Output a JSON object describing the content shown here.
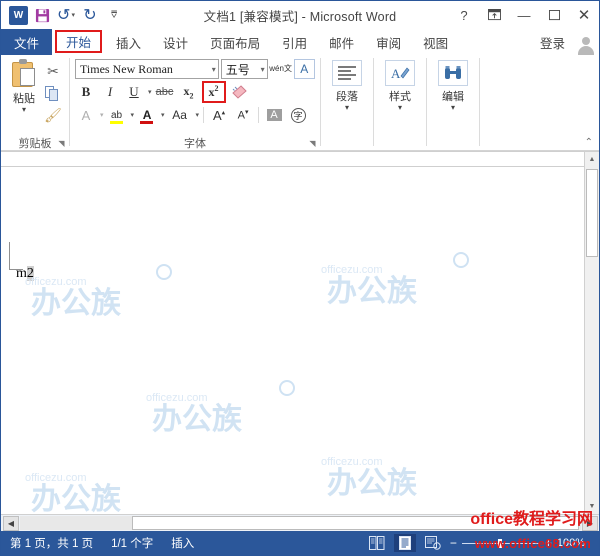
{
  "titlebar": {
    "document_title": "文档1 [兼容模式] - Microsoft Word",
    "quick_access": [
      {
        "name": "word-logo",
        "label": "W"
      },
      {
        "name": "save",
        "label": "Ὃe"
      },
      {
        "name": "undo",
        "label": "↰"
      },
      {
        "name": "redo",
        "label": "↻"
      },
      {
        "name": "customize-qat",
        "label": "⩲"
      }
    ],
    "help_label": "?",
    "ribbon_display_label": "⊡",
    "minimize_label": "—",
    "maximize_label": "▢",
    "close_label": "✕"
  },
  "tabs": {
    "file": "文件",
    "items": [
      {
        "label": "开始",
        "active": true
      },
      {
        "label": "插入",
        "active": false
      },
      {
        "label": "设计",
        "active": false
      },
      {
        "label": "页面布局",
        "active": false
      },
      {
        "label": "引用",
        "active": false
      },
      {
        "label": "邮件",
        "active": false
      },
      {
        "label": "审阅",
        "active": false
      },
      {
        "label": "视图",
        "active": false
      }
    ],
    "signin": "登录",
    "highlight_color": "#e01b1b"
  },
  "ribbon": {
    "clipboard": {
      "group_label": "剪贴板",
      "paste_label": "粘贴",
      "paste_caret": "▾",
      "cut_label": "✂",
      "copy_label": "copy",
      "format_painter_label": "🖌",
      "launcher": "◥"
    },
    "font": {
      "group_label": "字体",
      "font_name": "Times New Roman",
      "font_size": "五号",
      "caret": "▾",
      "bold": "B",
      "italic": "I",
      "underline": "U",
      "strikethrough": "abc",
      "subscript": "x₂",
      "superscript": "x²",
      "clear_formatting": "🧽",
      "text_effects": "A",
      "highlight": "ab",
      "font_color": "A",
      "change_case": "Aa",
      "grow_font": "A",
      "shrink_font": "A",
      "shading": "A",
      "char_border": "字",
      "phonetic_guide_top": "wén",
      "phonetic_guide_bottom": "文",
      "enclose_char": "A",
      "launcher": "◥"
    },
    "right_groups": [
      {
        "label": "段落",
        "icon": "paragraph-icon",
        "caret": "▾"
      },
      {
        "label": "样式",
        "icon": "styles-icon",
        "caret": "▾"
      },
      {
        "label": "编辑",
        "icon": "editing-icon",
        "caret": "▾"
      }
    ],
    "collapse_label": "⌃"
  },
  "document": {
    "text_before": "m",
    "text_selected": "2",
    "watermark_cn": "办公族",
    "watermark_en": "officezu.com"
  },
  "scrollbars": {
    "up_arrow": "▲",
    "down_arrow": "▼",
    "left_arrow": "◀",
    "right_arrow": "▶"
  },
  "statusbar": {
    "page_info": "第 1 页，共 1 页",
    "word_count": "1/1 个字",
    "insert_mode": "插入",
    "view_buttons": [
      {
        "name": "read-mode-icon",
        "label": "▤"
      },
      {
        "name": "print-layout-icon",
        "label": "▤"
      },
      {
        "name": "web-layout-icon",
        "label": "▦"
      }
    ],
    "zoom_minus": "−",
    "zoom_plus": "+",
    "zoom_percent": "100%"
  },
  "annotations": {
    "site_name": "office教程学习网",
    "site_url": "www.office68.com",
    "red": "#e01b1b"
  }
}
